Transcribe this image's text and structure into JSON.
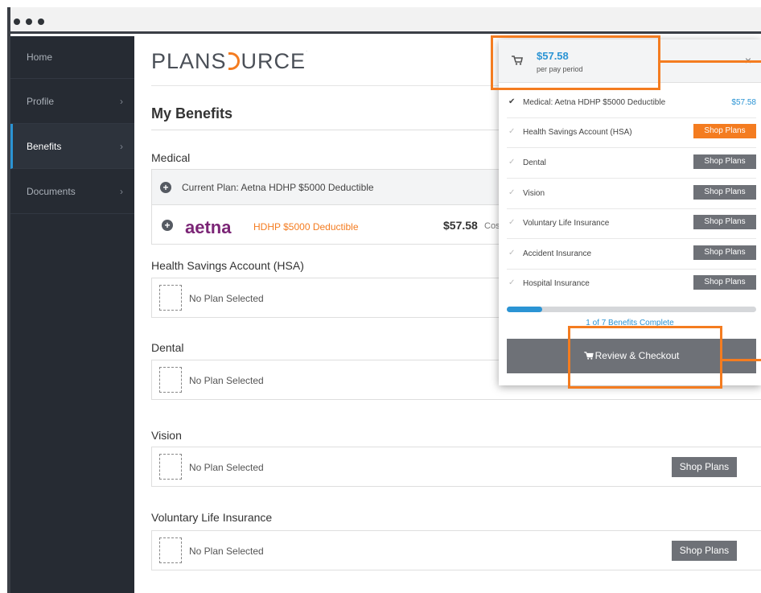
{
  "sidebar": {
    "items": [
      {
        "label": "Home"
      },
      {
        "label": "Profile"
      },
      {
        "label": "Benefits"
      },
      {
        "label": "Documents"
      }
    ]
  },
  "header": {
    "logo_prefix": "PLANS",
    "logo_suffix": "URCE",
    "logo_mark": "·"
  },
  "page": {
    "title": "My Benefits"
  },
  "medical": {
    "label": "Medical",
    "current_plan": "Current Plan: Aetna HDHP $5000 Deductible",
    "carrier": "aetna",
    "plan_name": "HDHP $5000 Deductible",
    "price": "$57.58",
    "cost_label": "Cos"
  },
  "hsa": {
    "label": "Health Savings Account (HSA)",
    "status": "No Plan Selected"
  },
  "dental": {
    "label": "Dental",
    "status": "No Plan Selected"
  },
  "vision": {
    "label": "Vision",
    "status": "No Plan Selected",
    "button": "Shop Plans"
  },
  "life": {
    "label": "Voluntary Life Insurance",
    "status": "No Plan Selected",
    "button": "Shop Plans"
  },
  "cart": {
    "total": "$57.58",
    "period": "per pay period",
    "close": "×",
    "rows": [
      {
        "label": "Medical: Aetna HDHP $5000 Deductible",
        "amount": "$57.58",
        "done": true
      },
      {
        "label": "Health Savings Account (HSA)",
        "button": "Shop Plans",
        "highlight": true
      },
      {
        "label": "Dental",
        "button": "Shop Plans"
      },
      {
        "label": "Vision",
        "button": "Shop Plans"
      },
      {
        "label": "Voluntary Life Insurance",
        "button": "Shop Plans"
      },
      {
        "label": "Accident Insurance",
        "button": "Shop Plans"
      },
      {
        "label": "Hospital Insurance",
        "button": "Shop Plans"
      }
    ],
    "progress_fraction": 0.1429,
    "progress_text": "1 of 7 Benefits Complete",
    "checkout_label": "Review & Checkout"
  },
  "colors": {
    "accent": "#f47c20",
    "link_blue": "#2b94d4",
    "sidebar_bg": "#262b33",
    "button_grey": "#6e7177",
    "aetna_purple": "#7b2576"
  },
  "icons": {
    "cart": "shopping-cart-icon",
    "close": "close-icon",
    "expand": "plus-circle-icon",
    "check": "checkmark-icon",
    "chevron": "chevron-right-icon"
  }
}
